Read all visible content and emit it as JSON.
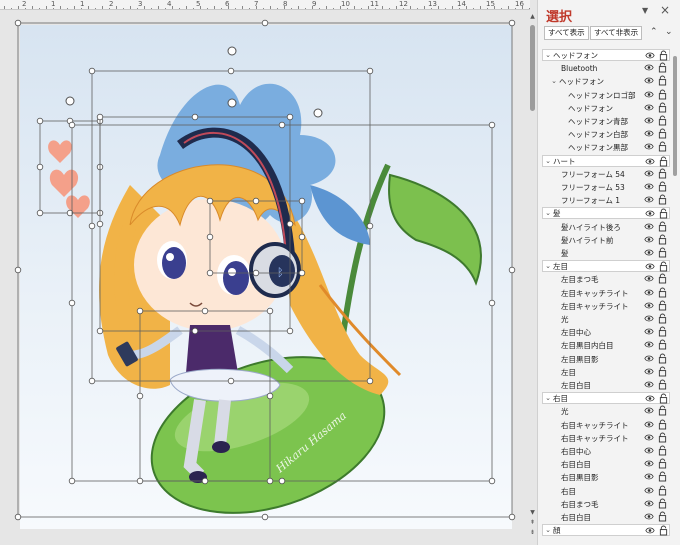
{
  "pane": {
    "title": "選択",
    "show_all": "すべて表示",
    "hide_all": "すべて非表示",
    "rows": [
      {
        "label": "ヘッドフォン",
        "indent": 0,
        "group": true,
        "expanded": true
      },
      {
        "label": "Bluetooth",
        "indent": 1,
        "group": false
      },
      {
        "label": "ヘッドフォン",
        "indent": 1,
        "group": false,
        "expanded": true,
        "subgroup": true
      },
      {
        "label": "ヘッドフォンロゴ部",
        "indent": 2,
        "group": false
      },
      {
        "label": "ヘッドフォン",
        "indent": 2,
        "group": false
      },
      {
        "label": "ヘッドフォン青部",
        "indent": 2,
        "group": false
      },
      {
        "label": "ヘッドフォン白部",
        "indent": 2,
        "group": false
      },
      {
        "label": "ヘッドフォン黒部",
        "indent": 2,
        "group": false
      },
      {
        "label": "ハート",
        "indent": 0,
        "group": true,
        "expanded": true
      },
      {
        "label": "フリーフォーム 54",
        "indent": 1,
        "group": false
      },
      {
        "label": "フリーフォーム 53",
        "indent": 1,
        "group": false
      },
      {
        "label": "フリーフォーム 1",
        "indent": 1,
        "group": false
      },
      {
        "label": "髪",
        "indent": 0,
        "group": true,
        "expanded": true
      },
      {
        "label": "髪ハイライト後ろ",
        "indent": 1,
        "group": false
      },
      {
        "label": "髪ハイライト前",
        "indent": 1,
        "group": false
      },
      {
        "label": "髪",
        "indent": 1,
        "group": false
      },
      {
        "label": "左目",
        "indent": 0,
        "group": true,
        "expanded": true
      },
      {
        "label": "左目まつ毛",
        "indent": 1,
        "group": false
      },
      {
        "label": "左目キャッチライト",
        "indent": 1,
        "group": false
      },
      {
        "label": "左目キャッチライト",
        "indent": 1,
        "group": false
      },
      {
        "label": "光",
        "indent": 1,
        "group": false
      },
      {
        "label": "左目中心",
        "indent": 1,
        "group": false
      },
      {
        "label": "左目黒目内白目",
        "indent": 1,
        "group": false
      },
      {
        "label": "左目黒目影",
        "indent": 1,
        "group": false
      },
      {
        "label": "左目",
        "indent": 1,
        "group": false
      },
      {
        "label": "左目白目",
        "indent": 1,
        "group": false
      },
      {
        "label": "右目",
        "indent": 0,
        "group": true,
        "expanded": true
      },
      {
        "label": "光",
        "indent": 1,
        "group": false
      },
      {
        "label": "右目キャッチライト",
        "indent": 1,
        "group": false
      },
      {
        "label": "右目キャッチライト",
        "indent": 1,
        "group": false
      },
      {
        "label": "右目中心",
        "indent": 1,
        "group": false
      },
      {
        "label": "右目白目",
        "indent": 1,
        "group": false
      },
      {
        "label": "右目黒目影",
        "indent": 1,
        "group": false
      },
      {
        "label": "右目",
        "indent": 1,
        "group": false
      },
      {
        "label": "右目まつ毛",
        "indent": 1,
        "group": false
      },
      {
        "label": "右目白目",
        "indent": 1,
        "group": false
      },
      {
        "label": "顔",
        "indent": 0,
        "group": true,
        "expanded": true
      }
    ]
  },
  "ruler": {
    "labels": [
      "2",
      "1",
      "1",
      "2",
      "3",
      "4",
      "5",
      "6",
      "7",
      "8",
      "9",
      "10",
      "11",
      "12",
      "13",
      "14",
      "15",
      "16"
    ]
  },
  "colors": {
    "title_red": "#c0392b",
    "note_green": "#4a9a3a",
    "hair_orange": "#f0b040",
    "headphone_blue": "#1f2b4d",
    "flower_blue": "#6fa0d8"
  },
  "signature": "Hikaru Hasama"
}
